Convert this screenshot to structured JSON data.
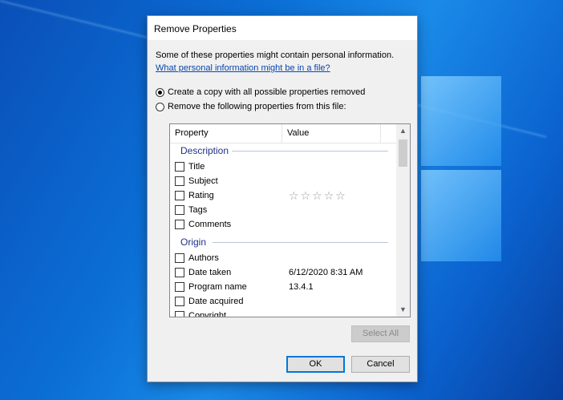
{
  "dialog": {
    "title": "Remove Properties",
    "intro": "Some of these properties might contain personal information.",
    "link": "What personal information might be in a file?"
  },
  "options": {
    "copy_label": "Create a copy with all possible properties removed",
    "remove_label": "Remove the following properties from this file:",
    "selected": "copy"
  },
  "list": {
    "columns": [
      "Property",
      "Value"
    ],
    "groups": [
      {
        "name": "Description",
        "items": [
          {
            "label": "Title",
            "value": ""
          },
          {
            "label": "Subject",
            "value": ""
          },
          {
            "label": "Rating",
            "value": "",
            "rating": 0
          },
          {
            "label": "Tags",
            "value": ""
          },
          {
            "label": "Comments",
            "value": ""
          }
        ]
      },
      {
        "name": "Origin",
        "items": [
          {
            "label": "Authors",
            "value": ""
          },
          {
            "label": "Date taken",
            "value": "6/12/2020 8:31 AM"
          },
          {
            "label": "Program name",
            "value": "13.4.1"
          },
          {
            "label": "Date acquired",
            "value": ""
          },
          {
            "label": "Copyright",
            "value": ""
          }
        ]
      }
    ]
  },
  "buttons": {
    "select_all": "Select All",
    "ok": "OK",
    "cancel": "Cancel"
  },
  "icons": {
    "scroll_up": "chevron-up-icon",
    "scroll_down": "chevron-down-icon",
    "rating_star": "star-outline-icon"
  },
  "colors": {
    "accent": "#0078d7",
    "group_header": "#1e3287",
    "link": "#0645ad"
  }
}
